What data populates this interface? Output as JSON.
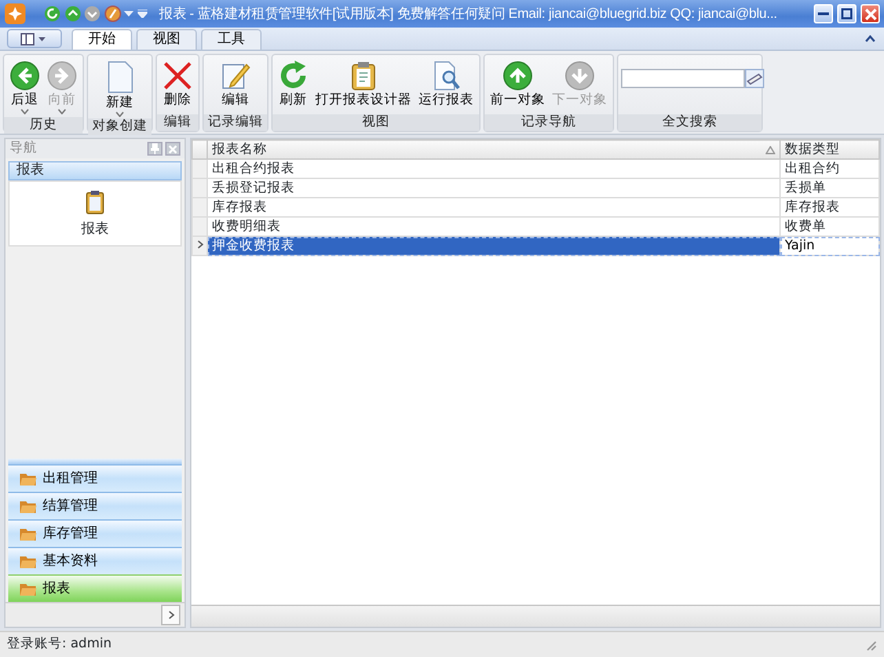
{
  "window": {
    "title": "报表 - 蓝格建材租赁管理软件[试用版本] 免费解答任何疑问 Email: jiancai@bluegrid.biz QQ: jiancai@blu..."
  },
  "tabs": [
    {
      "label": "开始",
      "selected": true
    },
    {
      "label": "视图",
      "selected": false
    },
    {
      "label": "工具",
      "selected": false
    }
  ],
  "ribbon": {
    "groups": [
      {
        "label": "历史",
        "kind": "buttons",
        "buttons": [
          {
            "label": "后退",
            "disabled": false,
            "dropdown": true
          },
          {
            "label": "向前",
            "disabled": true,
            "dropdown": true
          }
        ]
      },
      {
        "label": "对象创建",
        "kind": "buttons",
        "buttons": [
          {
            "label": "新建",
            "disabled": false,
            "dropdown": true
          }
        ]
      },
      {
        "label": "编辑",
        "kind": "buttons",
        "buttons": [
          {
            "label": "删除",
            "disabled": false,
            "dropdown": false
          }
        ]
      },
      {
        "label": "记录编辑",
        "kind": "buttons",
        "buttons": [
          {
            "label": "编辑",
            "disabled": false,
            "dropdown": false
          }
        ]
      },
      {
        "label": "视图",
        "kind": "buttons",
        "buttons": [
          {
            "label": "刷新",
            "disabled": false,
            "dropdown": false
          },
          {
            "label": "打开报表设计器",
            "disabled": false,
            "dropdown": false
          },
          {
            "label": "运行报表",
            "disabled": false,
            "dropdown": false
          }
        ]
      },
      {
        "label": "记录导航",
        "kind": "buttons",
        "buttons": [
          {
            "label": "前一对象",
            "disabled": false,
            "dropdown": false
          },
          {
            "label": "下一对象",
            "disabled": true,
            "dropdown": false
          }
        ]
      },
      {
        "label": "全文搜索",
        "kind": "search"
      }
    ]
  },
  "navigation": {
    "title": "导航",
    "section": "报表",
    "items": [
      {
        "label": "报表"
      }
    ],
    "groups": [
      {
        "label": "出租管理",
        "selected": false
      },
      {
        "label": "结算管理",
        "selected": false
      },
      {
        "label": "库存管理",
        "selected": false
      },
      {
        "label": "基本资料",
        "selected": false
      },
      {
        "label": "报表",
        "selected": true
      }
    ]
  },
  "table": {
    "columns": [
      {
        "label": "报表名称",
        "sorted": true
      },
      {
        "label": "数据类型",
        "sorted": false
      }
    ],
    "rows": [
      {
        "cells": [
          "出租合约报表",
          "出租合约"
        ],
        "selected": false
      },
      {
        "cells": [
          "丢损登记报表",
          "丢损单"
        ],
        "selected": false
      },
      {
        "cells": [
          "库存报表",
          "库存报表"
        ],
        "selected": false
      },
      {
        "cells": [
          "收费明细表",
          "收费单"
        ],
        "selected": false
      },
      {
        "cells": [
          "押金收费报表",
          "Yajin"
        ],
        "selected": true
      }
    ]
  },
  "status_bar": {
    "text": "登录账号: admin"
  }
}
